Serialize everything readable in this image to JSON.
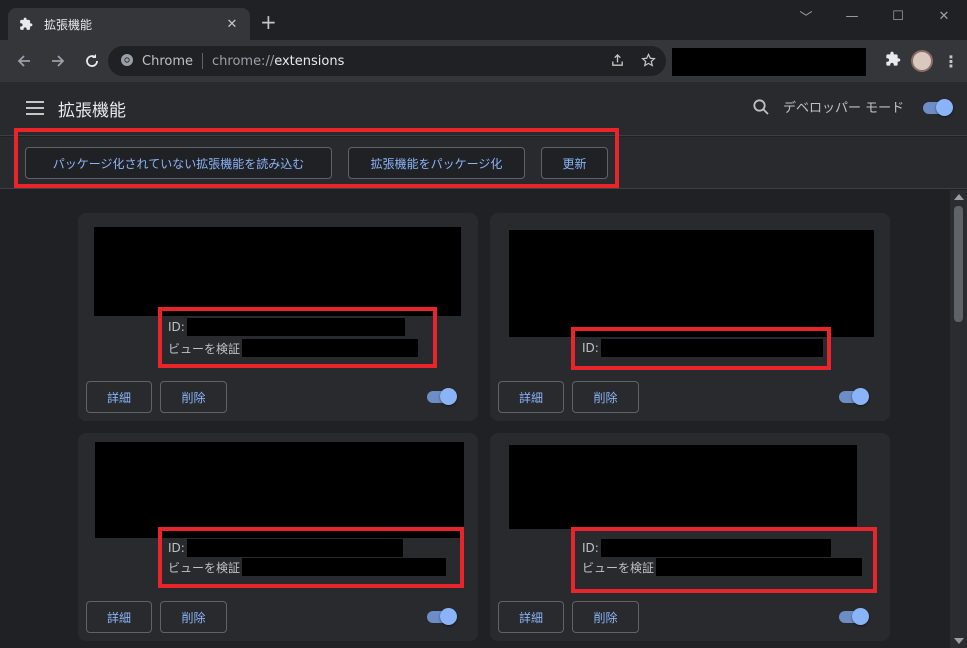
{
  "browser": {
    "tab_title": "拡張機能",
    "tab_close": "✕",
    "new_tab": "+",
    "site_label": "Chrome",
    "url_prefix": "chrome://",
    "url_main": "extensions",
    "window_controls": [
      "﹀",
      "—",
      "☐",
      "✕"
    ]
  },
  "page": {
    "title": "拡張機能",
    "developer_mode_label": "デベロッパー モード",
    "developer_mode_on": true
  },
  "actions": {
    "load_unpacked": "パッケージ化されていない拡張機能を読み込む",
    "pack_extension": "拡張機能をパッケージ化",
    "update": "更新"
  },
  "cards": [
    {
      "id_label": "ID:",
      "inspect_label": "ビューを検証",
      "details_label": "詳細",
      "remove_label": "削除",
      "enabled": true
    },
    {
      "id_label": "ID:",
      "inspect_label": "",
      "details_label": "詳細",
      "remove_label": "削除",
      "enabled": true
    },
    {
      "id_label": "ID:",
      "inspect_label": "ビューを検証",
      "details_label": "詳細",
      "remove_label": "削除",
      "enabled": true
    },
    {
      "id_label": "ID:",
      "inspect_label": "ビューを検証",
      "details_label": "詳細",
      "remove_label": "削除",
      "enabled": true
    }
  ],
  "colors": {
    "accent": "#8ab4f8",
    "highlight": "#e8252b",
    "background": "#202124",
    "card": "#292a2d"
  },
  "icons": [
    "puzzle-icon",
    "back-arrow-icon",
    "forward-arrow-icon",
    "reload-icon",
    "chrome-logo-icon",
    "share-icon",
    "star-icon",
    "extensions-icon",
    "menu-icon",
    "hamburger-icon",
    "search-icon"
  ]
}
